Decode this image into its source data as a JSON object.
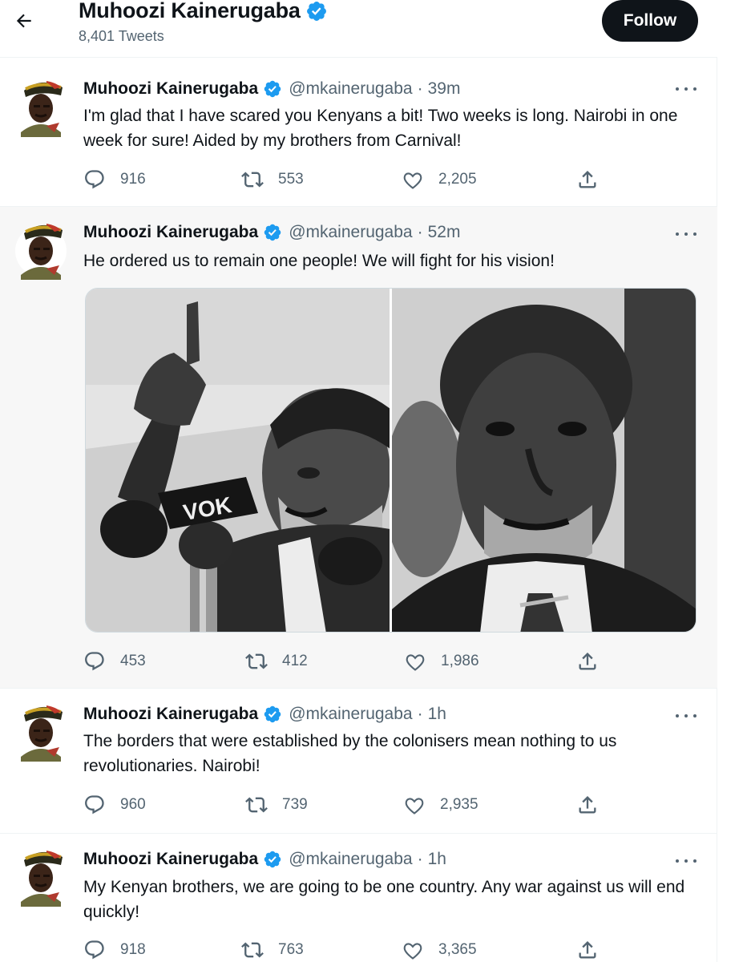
{
  "header": {
    "name": "Muhoozi Kainerugaba",
    "tweet_count": "8,401 Tweets",
    "follow_label": "Follow"
  },
  "colors": {
    "text": "#0f1419",
    "secondary": "#536471",
    "verified": "#1d9bf0",
    "follow_bg": "#0f1419",
    "shaded_row": "#f7f7f7"
  },
  "tweets": [
    {
      "name": "Muhoozi Kainerugaba",
      "handle": "@mkainerugaba",
      "dot": "·",
      "time": "39m",
      "text": "I'm glad that I have scared you Kenyans a bit! Two weeks is long. Nairobi in one week for sure! Aided by my brothers from Carnival!",
      "replies": "916",
      "retweets": "553",
      "likes": "2,205"
    },
    {
      "name": "Muhoozi Kainerugaba",
      "handle": "@mkainerugaba",
      "dot": "·",
      "time": "52m",
      "text": "He ordered us to remain one people! We will fight for his vision!",
      "media_text": "VOK",
      "replies": "453",
      "retweets": "412",
      "likes": "1,986"
    },
    {
      "name": "Muhoozi Kainerugaba",
      "handle": "@mkainerugaba",
      "dot": "·",
      "time": "1h",
      "text": "The borders that were established by the colonisers mean nothing to us revolutionaries. Nairobi!",
      "replies": "960",
      "retweets": "739",
      "likes": "2,935"
    },
    {
      "name": "Muhoozi Kainerugaba",
      "handle": "@mkainerugaba",
      "dot": "·",
      "time": "1h",
      "text": "My Kenyan brothers, we are going to be one country. Any war against us will end quickly!",
      "replies": "918",
      "retweets": "763",
      "likes": "3,365"
    }
  ],
  "icons": {
    "back": "back-arrow-icon",
    "verified": "verified-badge-icon",
    "more": "more-dots-icon",
    "reply": "reply-icon",
    "retweet": "retweet-icon",
    "like": "heart-icon",
    "share": "share-icon"
  }
}
